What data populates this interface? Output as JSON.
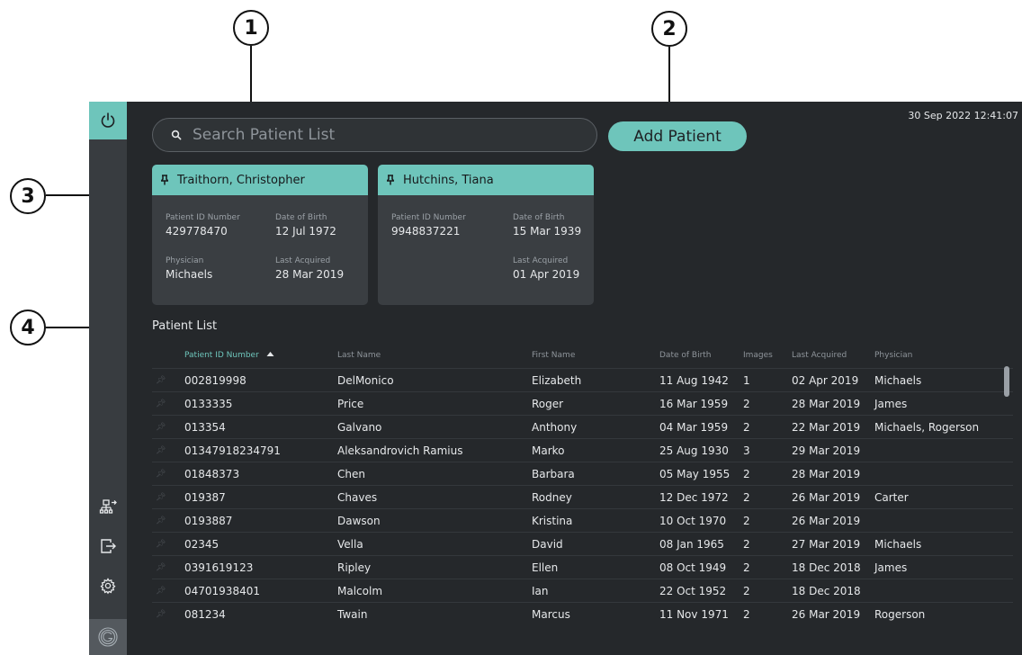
{
  "callouts": {
    "c1": "1",
    "c2": "2",
    "c3": "3",
    "c4": "4"
  },
  "header": {
    "datetime": "30 Sep 2022  12:41:07",
    "search_placeholder": "Search Patient List",
    "add_patient_label": "Add Patient"
  },
  "sidebar": {
    "icons": [
      "power-icon",
      "network-export-icon",
      "export-icon",
      "settings-gear-icon",
      "logo-icon"
    ]
  },
  "pinned": [
    {
      "name": "Traithorn, Christopher",
      "id_label": "Patient ID Number",
      "id": "429778470",
      "dob_label": "Date of Birth",
      "dob": "12 Jul 1972",
      "phys_label": "Physician",
      "physician": "Michaels",
      "last_label": "Last Acquired",
      "last": "28 Mar 2019"
    },
    {
      "name": "Hutchins, Tiana",
      "id_label": "Patient ID Number",
      "id": "9948837221",
      "dob_label": "Date of Birth",
      "dob": "15 Mar 1939",
      "last_label": "Last Acquired",
      "last": "01 Apr 2019"
    }
  ],
  "patient_list": {
    "title": "Patient List",
    "columns": [
      "Patient ID Number",
      "Last Name",
      "First Name",
      "Date of Birth",
      "Images",
      "Last Acquired",
      "Physician"
    ],
    "rows": [
      [
        "002819998",
        "DelMonico",
        "Elizabeth",
        "11 Aug 1942",
        "1",
        "02 Apr 2019",
        "Michaels"
      ],
      [
        "0133335",
        "Price",
        "Roger",
        "16 Mar 1959",
        "2",
        "28 Mar 2019",
        "James"
      ],
      [
        "013354",
        "Galvano",
        "Anthony",
        "04 Mar 1959",
        "2",
        "22 Mar 2019",
        "Michaels, Rogerson"
      ],
      [
        "01347918234791",
        "Aleksandrovich Ramius",
        "Marko",
        "25 Aug 1930",
        "3",
        "29 Mar 2019",
        ""
      ],
      [
        "01848373",
        "Chen",
        "Barbara",
        "05 May 1955",
        "2",
        "28 Mar 2019",
        ""
      ],
      [
        "019387",
        "Chaves",
        "Rodney",
        "12 Dec 1972",
        "2",
        "26 Mar 2019",
        "Carter"
      ],
      [
        "0193887",
        "Dawson",
        "Kristina",
        "10 Oct 1970",
        "2",
        "26 Mar 2019",
        ""
      ],
      [
        "02345",
        "Vella",
        "David",
        "08 Jan 1965",
        "2",
        "27 Mar 2019",
        "Michaels"
      ],
      [
        "0391619123",
        "Ripley",
        "Ellen",
        "08 Oct 1949",
        "2",
        "18 Dec 2018",
        "James"
      ],
      [
        "04701938401",
        "Malcolm",
        "Ian",
        "22 Oct 1952",
        "2",
        "18 Dec 2018",
        ""
      ],
      [
        "081234",
        "Twain",
        "Marcus",
        "11 Nov 1971",
        "2",
        "26 Mar 2019",
        "Rogerson"
      ]
    ]
  },
  "colors": {
    "accent": "#6ec5bb",
    "background": "#25282b",
    "sidebar": "#383c40",
    "card": "#3a3e42"
  }
}
